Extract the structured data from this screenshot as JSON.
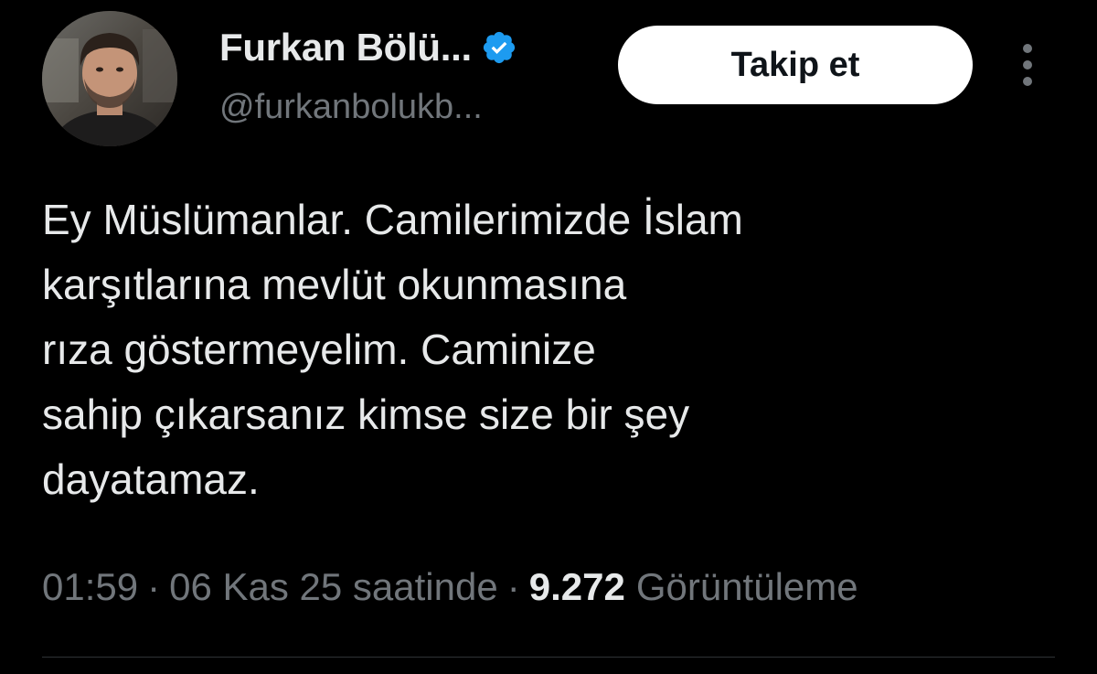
{
  "author": {
    "display_name": "Furkan Bölü...",
    "handle": "@furkanbolukb...",
    "verified": true,
    "avatar_icon": "profile-photo"
  },
  "actions": {
    "follow_label": "Takip et",
    "more_icon": "vertical-ellipsis-icon"
  },
  "tweet": {
    "lines": [
      "Ey Müslümanlar. Camilerimizde İslam",
      "karşıtlarına mevlüt okunmasına",
      "rıza göstermeyelim. Caminize",
      "sahip çıkarsanız kimse size bir şey",
      "dayatamaz."
    ]
  },
  "meta": {
    "time": "01:59",
    "separator": "·",
    "date": "06 Kas 25 saatinde",
    "views_count": "9.272",
    "views_label": "Görüntüleme"
  },
  "colors": {
    "background": "#000000",
    "text_primary": "#e7e9ea",
    "text_secondary": "#71767b",
    "verified_badge": "#1d9bf0",
    "follow_button_bg": "#ffffff",
    "divider": "#2f3336"
  }
}
